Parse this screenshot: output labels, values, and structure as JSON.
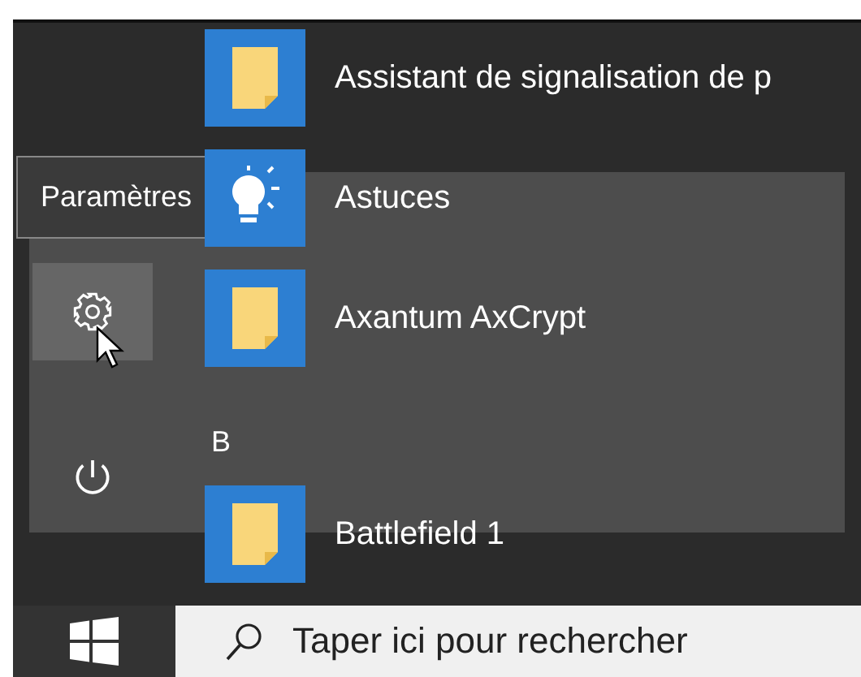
{
  "start_menu": {
    "tooltip": "Paramètres",
    "entries": [
      {
        "kind": "folder",
        "label": "Assistant de signalisation de p"
      },
      {
        "kind": "tips",
        "label": "Astuces"
      },
      {
        "kind": "folder",
        "label": "Axantum AxCrypt"
      },
      {
        "kind": "letter",
        "label": "B"
      },
      {
        "kind": "folder",
        "label": "Battlefield 1"
      }
    ]
  },
  "taskbar": {
    "search": {
      "placeholder": "Taper ici pour rechercher"
    }
  }
}
